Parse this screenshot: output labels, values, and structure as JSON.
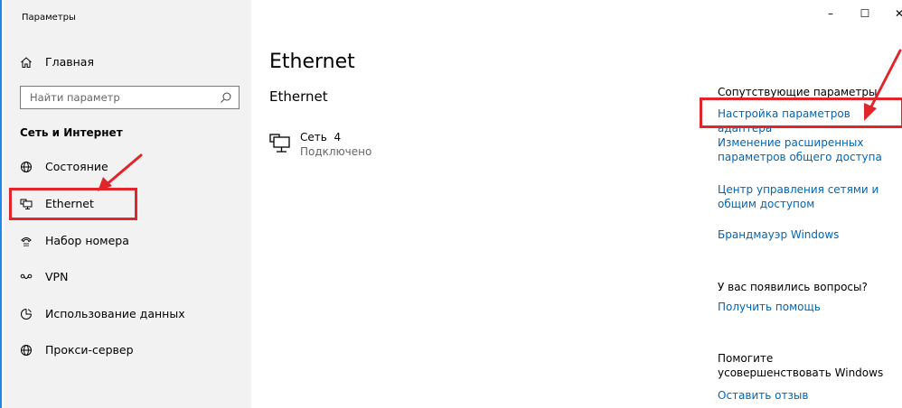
{
  "window": {
    "title": "Параметры",
    "controls": {
      "minimize": "–",
      "maximize": "☐",
      "close": "✕"
    }
  },
  "sidebar": {
    "home_label": "Главная",
    "search_placeholder": "Найти параметр",
    "section_title": "Сеть и Интернет",
    "items": [
      {
        "label": "Состояние",
        "icon": "globe-icon"
      },
      {
        "label": "Ethernet",
        "icon": "ethernet-icon"
      },
      {
        "label": "Набор номера",
        "icon": "dialup-icon"
      },
      {
        "label": "VPN",
        "icon": "vpn-icon"
      },
      {
        "label": "Использование данных",
        "icon": "data-usage-icon"
      },
      {
        "label": "Прокси-сервер",
        "icon": "globe-icon"
      }
    ]
  },
  "main": {
    "page_title": "Ethernet",
    "subtitle": "Ethernet",
    "network": {
      "name": "Сеть  4",
      "status": "Подключено"
    }
  },
  "related": {
    "heading": "Сопутствующие параметры",
    "links": [
      "Настройка параметров адаптера",
      "Изменение расширенных параметров общего доступа",
      "Центр управления сетями и общим доступом",
      "Брандмауэр Windows"
    ],
    "questions_heading": "У вас появились вопросы?",
    "help_link": "Получить помощь",
    "improve_heading": "Помогите усовершенствовать Windows",
    "feedback_link": "Оставить отзыв"
  },
  "colors": {
    "accent": "#0066b4",
    "highlight": "#e0262a",
    "sidebar_bg": "#f2f2f2",
    "window_border": "#1e88e5"
  }
}
